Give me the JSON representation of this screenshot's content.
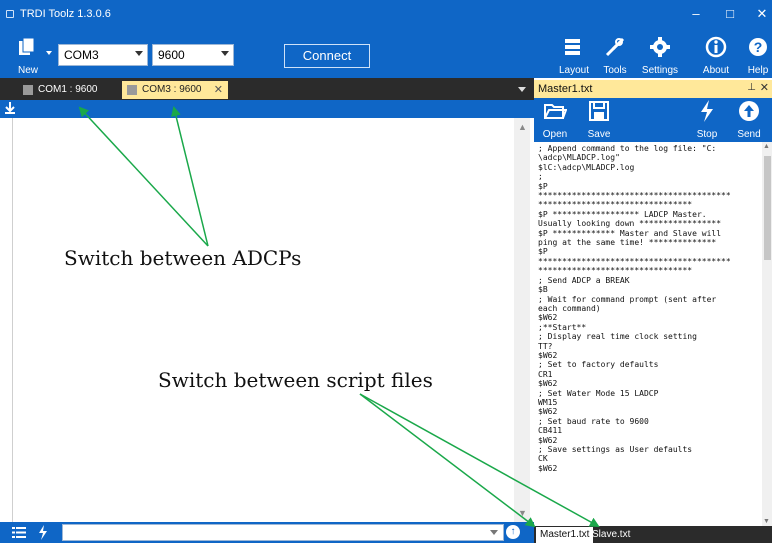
{
  "window": {
    "title": "TRDI Toolz 1.3.0.6",
    "controls": [
      "–",
      "□",
      "✕"
    ]
  },
  "toolbar": {
    "new_label": "New",
    "port_value": "COM3",
    "baud_value": "9600",
    "connect_label": "Connect",
    "right_tools": [
      {
        "label": "Layout",
        "icon": "layout-icon"
      },
      {
        "label": "Tools",
        "icon": "tools-icon"
      },
      {
        "label": "Settings",
        "icon": "gear-icon"
      },
      {
        "label": "About",
        "icon": "info-icon"
      },
      {
        "label": "Help",
        "icon": "help-icon"
      }
    ]
  },
  "terminal_tabs": [
    {
      "label": "COM1 : 9600",
      "active": false
    },
    {
      "label": "COM3 : 9600",
      "active": true,
      "close": "✕"
    }
  ],
  "script_panel": {
    "title": "Master1.txt",
    "pin": "⊥",
    "close": "✕",
    "buttons": {
      "open": "Open",
      "save": "Save",
      "stop": "Stop",
      "send": "Send"
    },
    "lines": [
      "; Append command to the log file: \"C:",
      "\\adcp\\MLADCP.log\"",
      "$lC:\\adcp\\MLADCP.log",
      ";",
      "$P",
      "****************************************",
      "********************************",
      "$P ****************** LADCP Master.",
      "Usually looking down *****************",
      "$P ************* Master and Slave will",
      "ping at the same time! **************",
      "$P",
      "****************************************",
      "********************************",
      "; Send ADCP a BREAK",
      "$B",
      "; Wait for command prompt (sent after",
      "each command)",
      "$W62",
      ";**Start**",
      "; Display real time clock setting",
      "TT?",
      "$W62",
      "; Set to factory defaults",
      "CR1",
      "$W62",
      "; Set Water Mode 15 LADCP",
      "WM15",
      "$W62",
      "; Set baud rate to 9600",
      "CB411",
      "$W62",
      "; Save settings as User defaults",
      "CK",
      "$W62"
    ],
    "file_tabs": [
      {
        "label": "Master1.txt",
        "active": true
      },
      {
        "label": "Slave.txt",
        "active": false
      }
    ]
  },
  "annotations": {
    "switch_adcps": "Switch between ADCPs",
    "switch_scripts": "Switch between script files",
    "arrow_color": "#1aa84a"
  },
  "colors": {
    "accent": "#0f66c6",
    "active_tab": "#ffe89a",
    "dark_strip": "#2b2b2b"
  }
}
